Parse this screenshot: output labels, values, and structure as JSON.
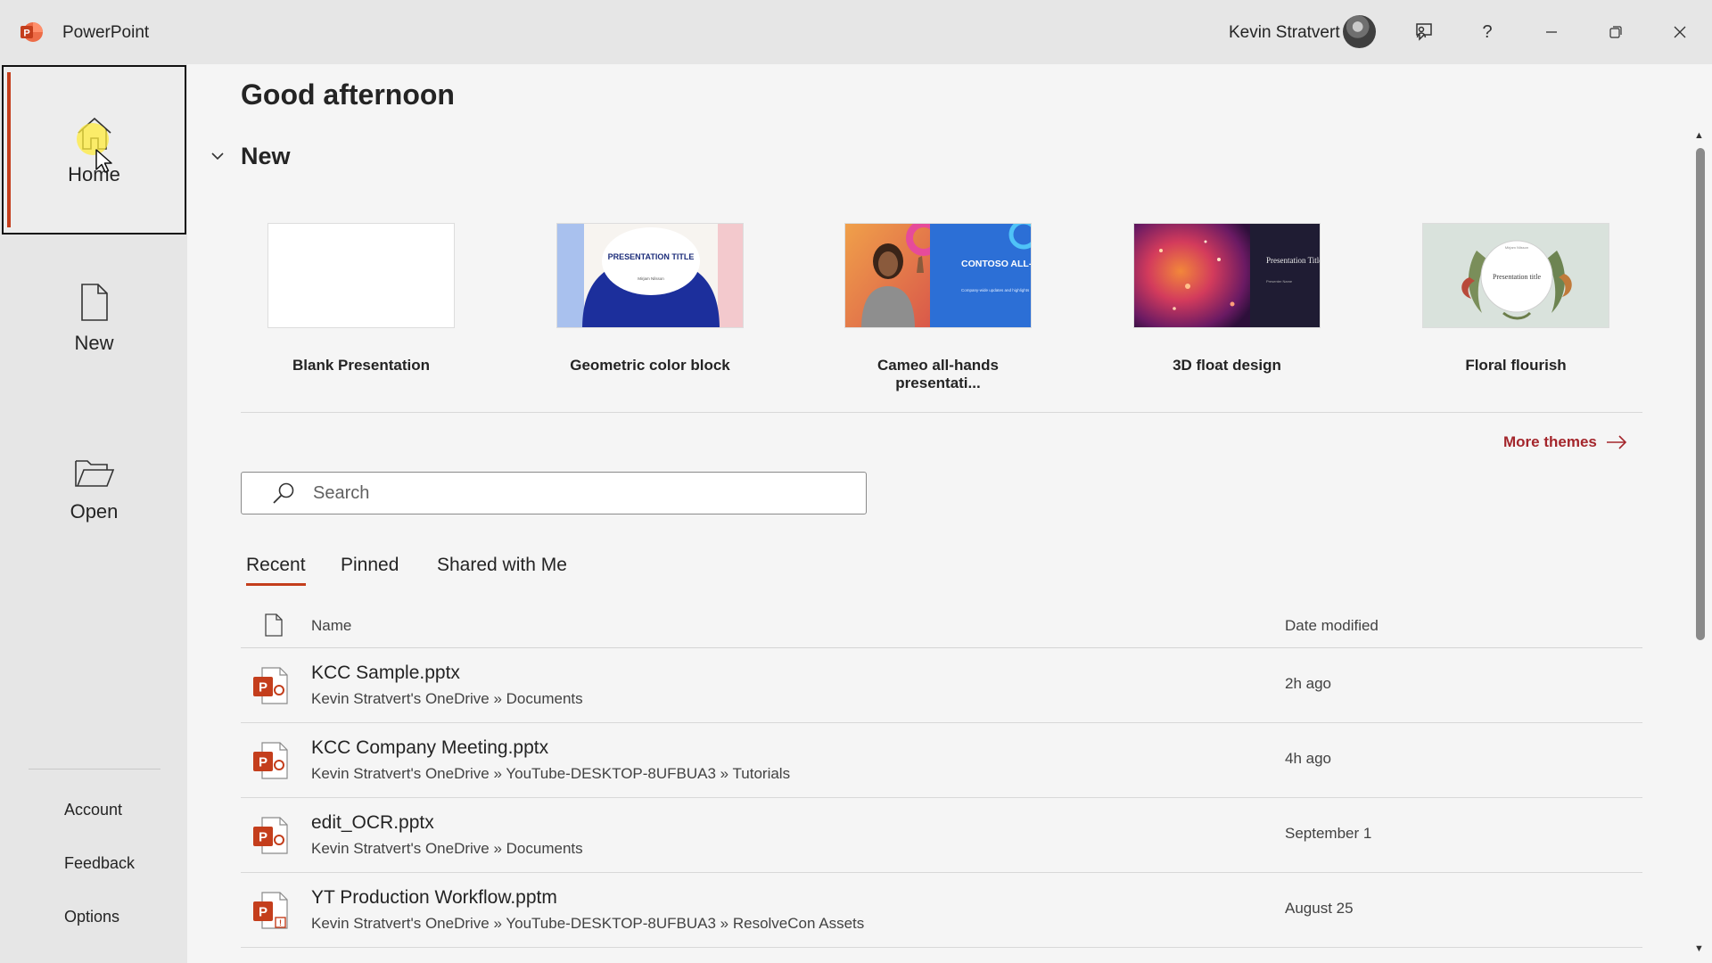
{
  "app": {
    "name": "PowerPoint",
    "accent_color": "#c43e1c",
    "link_color": "#a4262c"
  },
  "titlebar": {
    "user_name": "Kevin Stratvert",
    "icons": [
      "feedback-icon",
      "help-icon",
      "minimize-icon",
      "restore-icon",
      "close-icon"
    ],
    "help_glyph": "?"
  },
  "sidebar": {
    "items": [
      {
        "label": "Home",
        "icon": "home-icon",
        "active": true
      },
      {
        "label": "New",
        "icon": "new-document-icon",
        "active": false
      },
      {
        "label": "Open",
        "icon": "folder-open-icon",
        "active": false
      }
    ],
    "bottom_links": [
      "Account",
      "Feedback",
      "Options"
    ]
  },
  "main": {
    "greeting": "Good afternoon",
    "new_section": {
      "title": "New",
      "templates": [
        {
          "name": "Blank Presentation"
        },
        {
          "name": "Geometric color block",
          "thumb_title": "PRESENTATION TITLE",
          "thumb_subtitle": "Mirjam Nilsson"
        },
        {
          "name": "Cameo all-hands presentati...",
          "thumb_title": "CONTOSO ALL-HANDS",
          "thumb_subtitle": "Company-wide updates and highlights"
        },
        {
          "name": "3D float design",
          "thumb_title": "Presentation Title",
          "thumb_subtitle": "Presenter Name"
        },
        {
          "name": "Floral flourish",
          "thumb_title": "Presentation title",
          "thumb_subtitle": "Mirjam Nilsson"
        }
      ],
      "more_themes": "More themes"
    },
    "search": {
      "placeholder": "Search",
      "value": ""
    },
    "tabs": [
      {
        "label": "Recent",
        "active": true
      },
      {
        "label": "Pinned",
        "active": false
      },
      {
        "label": "Shared with Me",
        "active": false
      }
    ],
    "table": {
      "columns": {
        "name": "Name",
        "date": "Date modified"
      },
      "rows": [
        {
          "name": "KCC Sample.pptx",
          "path": "Kevin Stratvert's OneDrive » Documents",
          "date": "2h ago",
          "type": "pptx"
        },
        {
          "name": "KCC Company Meeting.pptx",
          "path": "Kevin Stratvert's OneDrive » YouTube-DESKTOP-8UFBUA3 » Tutorials",
          "date": "4h ago",
          "type": "pptx"
        },
        {
          "name": "edit_OCR.pptx",
          "path": "Kevin Stratvert's OneDrive » Documents",
          "date": "September 1",
          "type": "pptx"
        },
        {
          "name": "YT Production Workflow.pptm",
          "path": "Kevin Stratvert's OneDrive » YouTube-DESKTOP-8UFBUA3 » ResolveCon Assets",
          "date": "August 25",
          "type": "pptm"
        }
      ]
    }
  }
}
